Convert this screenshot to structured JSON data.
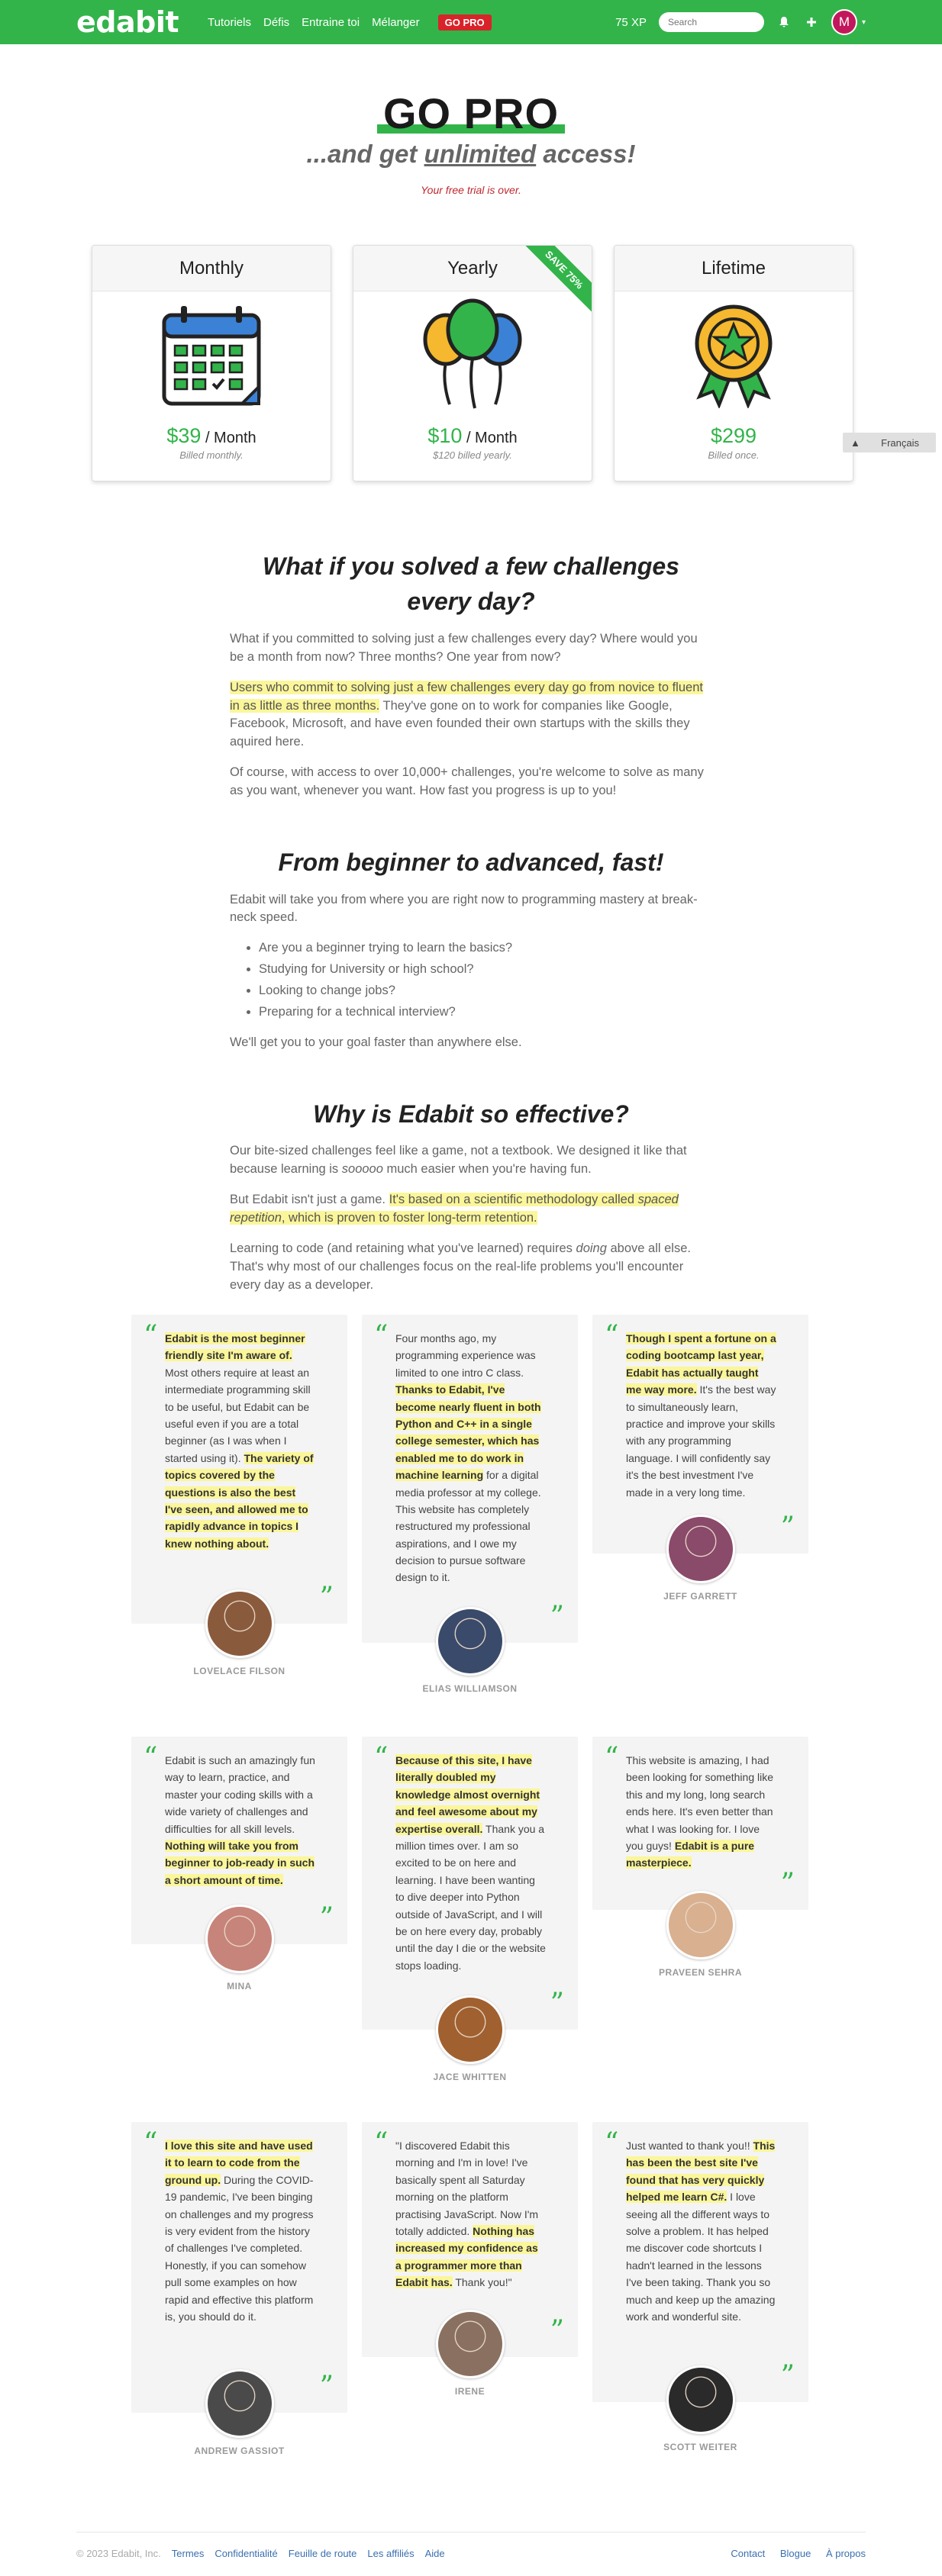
{
  "nav": {
    "logo": "edabit",
    "links": [
      "Tutoriels",
      "Défis",
      "Entraine toi",
      "Mélanger"
    ],
    "gopro": "GO PRO",
    "xp": "75 XP",
    "search_placeholder": "Search",
    "avatar_letter": "M"
  },
  "hero": {
    "title": "GO PRO",
    "sub_pre": "...and get ",
    "sub_u": "unlimited",
    "sub_post": " access!",
    "trial": "Your free trial is over."
  },
  "plans": [
    {
      "name": "Monthly",
      "price": "$39",
      "per": " / Month",
      "billed": "Billed monthly.",
      "icon": "calendar-icon"
    },
    {
      "name": "Yearly",
      "price": "$10",
      "per": " / Month",
      "billed": "$120 billed yearly.",
      "icon": "balloons-icon",
      "ribbon": "SAVE 75%"
    },
    {
      "name": "Lifetime",
      "price": "$299",
      "per": "",
      "billed": "Billed once.",
      "icon": "medal-icon"
    }
  ],
  "lang": {
    "label": "Français"
  },
  "sections": {
    "s1": {
      "title": "What if you solved a few challenges every day?",
      "p1": "What if you committed to solving just a few challenges every day? Where would you be a month from now? Three months? One year from now?",
      "p2_hl": "Users who commit to solving just a few challenges every day go from novice to fluent in as little as three months.",
      "p2_rest": " They've gone on to work for companies like Google, Facebook, Microsoft, and have even founded their own startups with the skills they aquired here.",
      "p3": "Of course, with access to over 10,000+ challenges, you're welcome to solve as many as you want, whenever you want. How fast you progress is up to you!"
    },
    "s2": {
      "title": "From beginner to advanced, fast!",
      "p1": "Edabit will take you from where you are right now to programming mastery at break-neck speed.",
      "list": [
        "Are you a beginner trying to learn the basics?",
        "Studying for University or high school?",
        "Looking to change jobs?",
        "Preparing for a technical interview?"
      ],
      "p2": "We'll get you to your goal faster than anywhere else."
    },
    "s3": {
      "title": "Why is Edabit so effective?",
      "p1_pre": "Our bite-sized challenges feel like a game, not a textbook. We designed it like that because learning is ",
      "p1_em": "sooooo",
      "p1_post": " much easier when you're having fun.",
      "p2_pre": "But Edabit isn't just a game. ",
      "p2_hl1": "It's based on a scientific methodology called ",
      "p2_hl_em": "spaced repetition",
      "p2_hl2": ", which is proven to foster long-term retention.",
      "p3_pre": "Learning to code (and retaining what you've learned) requires ",
      "p3_em": "doing",
      "p3_post": " above all else. That's why most of our challenges focus on the real-life problems you'll encounter every day as a developer."
    }
  },
  "testimonials": [
    {
      "name": "LOVELACE FILSON",
      "parts": [
        [
          "h",
          "Edabit is the most beginner friendly site I'm aware of."
        ],
        [
          "t",
          " Most others require at least an intermediate programming skill to be useful, but Edabit can be useful even if you are a total beginner (as I was when I started using it). "
        ],
        [
          "h",
          "The variety of topics covered by the questions is also the best I've seen, and allowed me to rapidly advance in topics I knew nothing about."
        ]
      ]
    },
    {
      "name": "ELIAS WILLIAMSON",
      "parts": [
        [
          "t",
          "Four months ago, my programming experience was limited to one intro C class. "
        ],
        [
          "h",
          "Thanks to Edabit, I've become nearly fluent in both Python and C++ in a single college semester, which has enabled me to do work in machine learning"
        ],
        [
          "t",
          " for a digital media professor at my college. This website has completely restructured my professional aspirations, and I owe my decision to pursue software design to it."
        ]
      ]
    },
    {
      "name": "JEFF GARRETT",
      "parts": [
        [
          "h",
          "Though I spent a fortune on a coding bootcamp last year, Edabit has actually taught me way more."
        ],
        [
          "t",
          " It's the best way to simultaneously learn, practice and improve your skills with any programming language. I will confidently say it's the best investment I've made in a very long time."
        ]
      ]
    },
    {
      "name": "MINA",
      "parts": [
        [
          "t",
          "Edabit is such an amazingly fun way to learn, practice, and master your coding skills with a wide variety of challenges and difficulties for all skill levels. "
        ],
        [
          "h",
          "Nothing will take you from beginner to job-ready in such a short amount of time."
        ]
      ]
    },
    {
      "name": "JACE WHITTEN",
      "parts": [
        [
          "h",
          "Because of this site, I have literally doubled my knowledge almost overnight and feel awesome about my expertise overall."
        ],
        [
          "t",
          " Thank you a million times over. I am so excited to be on here and learning. I have been wanting to dive deeper into Python outside of JavaScript, and I will be on here every day, probably until the day I die or the website stops loading."
        ]
      ]
    },
    {
      "name": "PRAVEEN SEHRA",
      "parts": [
        [
          "t",
          "This website is amazing, I had been looking for something like this and my long, long search ends here. It's even better than what I was looking for. I love you guys! "
        ],
        [
          "h",
          "Edabit is a pure masterpiece."
        ]
      ]
    },
    {
      "name": "ANDREW GASSIOT",
      "parts": [
        [
          "h",
          "I love this site and have used it to learn to code from the ground up."
        ],
        [
          "t",
          " During the COVID-19 pandemic, I've been binging on challenges and my progress is very evident from the history of challenges I've completed. Honestly, if you can somehow pull some examples on how rapid and effective this platform is, you should do it."
        ]
      ]
    },
    {
      "name": "IRENE",
      "parts": [
        [
          "t",
          "\"I discovered Edabit this morning and I'm in love! I've basically spent all Saturday morning on the platform practising JavaScript. Now I'm totally addicted. "
        ],
        [
          "h",
          "Nothing has increased my confidence as a programmer more than Edabit has."
        ],
        [
          "t",
          " Thank you!\""
        ]
      ]
    },
    {
      "name": "SCOTT WEITER",
      "parts": [
        [
          "t",
          "Just wanted to thank you!! "
        ],
        [
          "h",
          "This has been the best site I've found that has very quickly helped me learn C#."
        ],
        [
          "t",
          " I love seeing all the different ways to solve a problem. It has helped me discover code shortcuts I hadn't learned in the lessons I've been taking. Thank you so much and keep up the amazing work and wonderful site."
        ]
      ]
    }
  ],
  "footer": {
    "copyright": "© 2023 Edabit, Inc.",
    "left_links": [
      "Termes",
      "Confidentialité",
      "Feuille de route",
      "Les affiliés",
      "Aide"
    ],
    "right_links": [
      "Contact",
      "Blogue",
      "À propos"
    ]
  },
  "colors": {
    "brand_green": "#32b44a",
    "highlight": "#fbf69a",
    "alert_red": "#c0282d"
  }
}
